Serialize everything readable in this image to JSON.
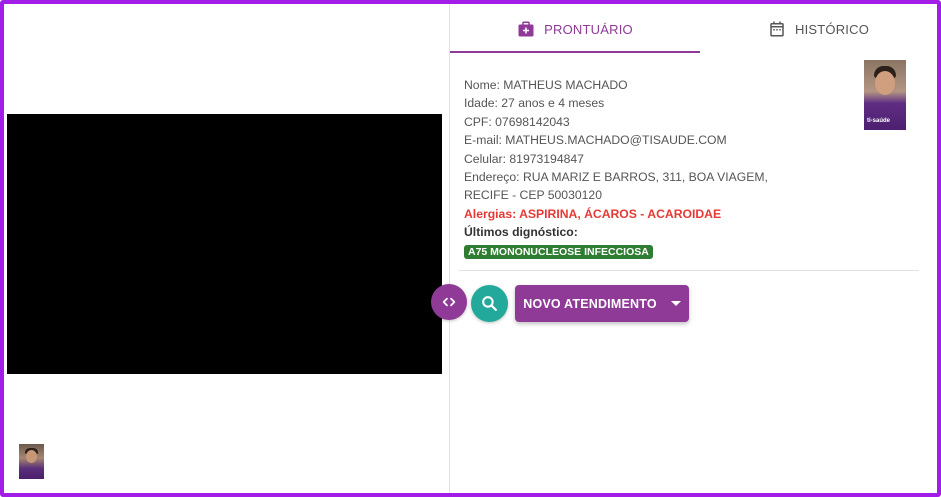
{
  "tabs": [
    {
      "label": "PRONTUÁRIO",
      "icon": "medical-bag-icon",
      "active": true
    },
    {
      "label": "HISTÓRICO",
      "icon": "calendar-icon",
      "active": false
    }
  ],
  "patient": {
    "nome": "Nome: MATHEUS MACHADO",
    "idade": "Idade: 27 anos e 4 meses",
    "cpf": "CPF: 07698142043",
    "email": "E-mail: MATHEUS.MACHADO@TISAUDE.COM",
    "celular": "Celular: 81973194847",
    "endereco_1": "Endereço: RUA MARIZ E BARROS, 311, BOA VIAGEM,",
    "endereco_2": "RECIFE - CEP 50030120",
    "alergias": "Alergias: ASPIRINA, ÁCAROS - ACAROIDAE",
    "diagnostico_title": "Últimos dignóstico:",
    "diagnostico": "A75 MONONUCLEOSE INFECCIOSA",
    "photo_brand": "ti-saúde"
  },
  "actions": {
    "novo_atendimento": "NOVO ATENDIMENTO"
  },
  "colors": {
    "frame": "#a21ee8",
    "primary": "#8e3a96",
    "teal": "#22a99b",
    "allergy": "#e53935",
    "badge": "#2e7d32"
  }
}
